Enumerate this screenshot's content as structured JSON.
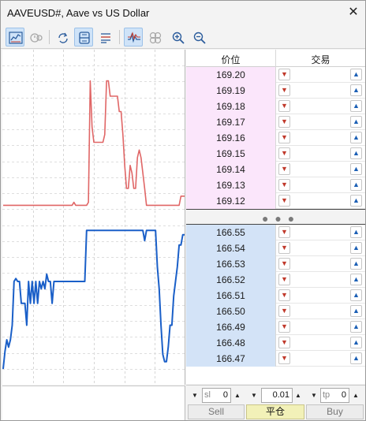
{
  "window": {
    "title": "AAVEUSD#, Aave vs US Dollar",
    "close_glyph": "✕"
  },
  "toolbar": {
    "buttons": [
      {
        "name": "chart-icon",
        "active": true
      },
      {
        "name": "history-icon",
        "active": false
      },
      {
        "name": "sync-icon",
        "active": false
      },
      {
        "name": "split-view-icon",
        "active": true
      },
      {
        "name": "list-settings-icon",
        "active": false
      },
      {
        "name": "tick-chart-icon",
        "active": true
      },
      {
        "name": "bubbles-icon",
        "active": false
      },
      {
        "name": "zoom-in-icon",
        "active": false
      },
      {
        "name": "zoom-out-icon",
        "active": false
      }
    ]
  },
  "chart_data": {
    "type": "line",
    "series": [
      {
        "color": "#e06666",
        "values": [
          0.09,
          0.09,
          0.09,
          0.09,
          0.09,
          0.09,
          0.09,
          0.09,
          0.09,
          0.09,
          0.09,
          0.09,
          0.09,
          0.09,
          0.09,
          0.09,
          0.09,
          0.09,
          0.09,
          0.09,
          0.09,
          0.09,
          0.09,
          0.09,
          0.09,
          0.09,
          0.09,
          0.09,
          0.09,
          0.09,
          0.09,
          0.09,
          0.09,
          0.09,
          0.09,
          0.09,
          0.09,
          0.09,
          0.09,
          0.11,
          0.09,
          0.09,
          0.09,
          0.09,
          0.09,
          0.09,
          0.09,
          0.11,
          0.9,
          0.6,
          0.5,
          0.5,
          0.5,
          0.5,
          0.5,
          0.5,
          0.55,
          0.9,
          0.9,
          0.8,
          0.8,
          0.8,
          0.8,
          0.8,
          0.7,
          0.7,
          0.55,
          0.35,
          0.2,
          0.2,
          0.35,
          0.3,
          0.2,
          0.2,
          0.4,
          0.45,
          0.4,
          0.3,
          0.2,
          0.09,
          0.09,
          0.09,
          0.09,
          0.09,
          0.09,
          0.09,
          0.09,
          0.09,
          0.09,
          0.09,
          0.09,
          0.09,
          0.09,
          0.09,
          0.09,
          0.09,
          0.09,
          0.09,
          0.15,
          0.15,
          0.15
        ]
      },
      {
        "color": "#1a5fc8",
        "values": [
          0.0,
          0.12,
          0.2,
          0.15,
          0.2,
          0.3,
          0.6,
          0.62,
          0.6,
          0.6,
          0.45,
          0.45,
          0.45,
          0.3,
          0.6,
          0.45,
          0.6,
          0.45,
          0.6,
          0.45,
          0.6,
          0.55,
          0.6,
          0.55,
          0.65,
          0.6,
          0.6,
          0.45,
          0.6,
          0.6,
          0.6,
          0.6,
          0.6,
          0.6,
          0.6,
          0.6,
          0.6,
          0.6,
          0.6,
          0.6,
          0.6,
          0.6,
          0.6,
          0.6,
          0.6,
          0.6,
          0.95,
          0.95,
          0.95,
          0.95,
          0.95,
          0.95,
          0.95,
          0.95,
          0.95,
          0.95,
          0.95,
          0.95,
          0.95,
          0.95,
          0.95,
          0.95,
          0.95,
          0.95,
          0.95,
          0.95,
          0.95,
          0.95,
          0.95,
          0.95,
          0.95,
          0.95,
          0.95,
          0.95,
          0.95,
          0.95,
          0.95,
          0.95,
          0.88,
          0.95,
          0.95,
          0.95,
          0.95,
          0.95,
          0.95,
          0.7,
          0.55,
          0.3,
          0.1,
          0.05,
          0.05,
          0.15,
          0.3,
          0.3,
          0.5,
          0.6,
          0.7,
          0.85,
          0.85,
          0.92,
          0.92
        ]
      }
    ]
  },
  "book": {
    "headers": {
      "price": "价位",
      "trade": "交易"
    },
    "asks": [
      "169.20",
      "169.19",
      "169.18",
      "169.17",
      "169.16",
      "169.15",
      "169.14",
      "169.13",
      "169.12"
    ],
    "bids": [
      "166.55",
      "166.54",
      "166.53",
      "166.52",
      "166.51",
      "166.50",
      "166.49",
      "166.48",
      "166.47"
    ],
    "spread_glyph": "● ● ●",
    "down_glyph": "▼",
    "up_glyph": "▲"
  },
  "controls": {
    "sl": {
      "label": "sl",
      "value": "0"
    },
    "volume": {
      "value": "0.01"
    },
    "tp": {
      "label": "tp",
      "value": "0"
    },
    "down_glyph": "▼",
    "up_glyph": "▲",
    "sell_label": "Sell",
    "close_label": "平仓",
    "buy_label": "Buy"
  }
}
